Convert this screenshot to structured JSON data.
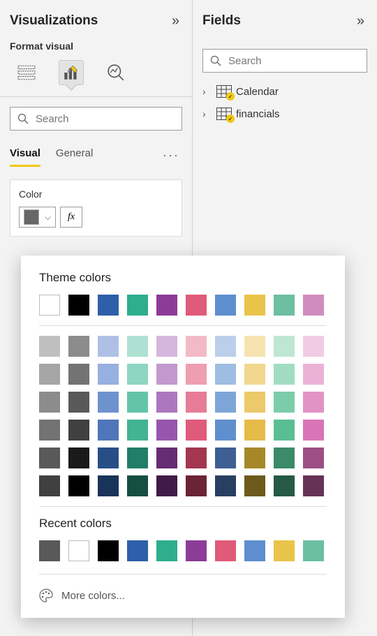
{
  "panels": {
    "visualizations": {
      "title": "Visualizations",
      "subheader": "Format visual"
    },
    "fields": {
      "title": "Fields"
    }
  },
  "search": {
    "placeholder": "Search"
  },
  "format_tabs": {
    "visual": "Visual",
    "general": "General"
  },
  "card": {
    "label": "Color",
    "fx": "fx"
  },
  "popup": {
    "theme_title": "Theme colors",
    "recent_title": "Recent colors",
    "more": "More colors...",
    "theme_row1": [
      "#FFFFFF",
      "#000000",
      "#2E5FAA",
      "#2EAE8D",
      "#8C3C96",
      "#E05A79",
      "#5E8ECF",
      "#E9C44B",
      "#6CBFA0",
      "#D18CBE"
    ],
    "shades": [
      [
        "#BFBFBF",
        "#8C8C8C",
        "#AFC0E5",
        "#AEE1D2",
        "#D5B7DE",
        "#F3BAC6",
        "#BBCFEA",
        "#F6E3B0",
        "#BEE6D3",
        "#F1CBE3"
      ],
      [
        "#A6A6A6",
        "#737373",
        "#96B0DF",
        "#8DD6C1",
        "#C299CF",
        "#EE9EB1",
        "#9FBCE2",
        "#F2D78F",
        "#A1DCC1",
        "#EBB2D6"
      ],
      [
        "#8C8C8C",
        "#595959",
        "#6E92CE",
        "#64C4A7",
        "#AC77BF",
        "#E77C96",
        "#7EA5D8",
        "#ECC969",
        "#7BCDA9",
        "#E293C6"
      ],
      [
        "#737373",
        "#404040",
        "#4E76B9",
        "#42B492",
        "#9656AE",
        "#E05A79",
        "#608FCD",
        "#E6BB48",
        "#59BF93",
        "#D974B6"
      ],
      [
        "#595959",
        "#1A1A1A",
        "#294E86",
        "#217E67",
        "#662C72",
        "#A2374F",
        "#3E5F94",
        "#A78829",
        "#3B8A6A",
        "#9B4F84"
      ],
      [
        "#404040",
        "#000000",
        "#1A3459",
        "#154F41",
        "#401B48",
        "#6B2434",
        "#283F62",
        "#6E5A1B",
        "#265A45",
        "#663357"
      ]
    ],
    "recent": [
      "#595959",
      "#FFFFFF",
      "#000000",
      "#2E5FAA",
      "#2EAE8D",
      "#8C3C96",
      "#E05A79",
      "#5E8ECF",
      "#E9C44B",
      "#6CBFA0"
    ]
  },
  "fields_list": [
    {
      "label": "Calendar"
    },
    {
      "label": "financials"
    }
  ],
  "current_color": "#666666"
}
